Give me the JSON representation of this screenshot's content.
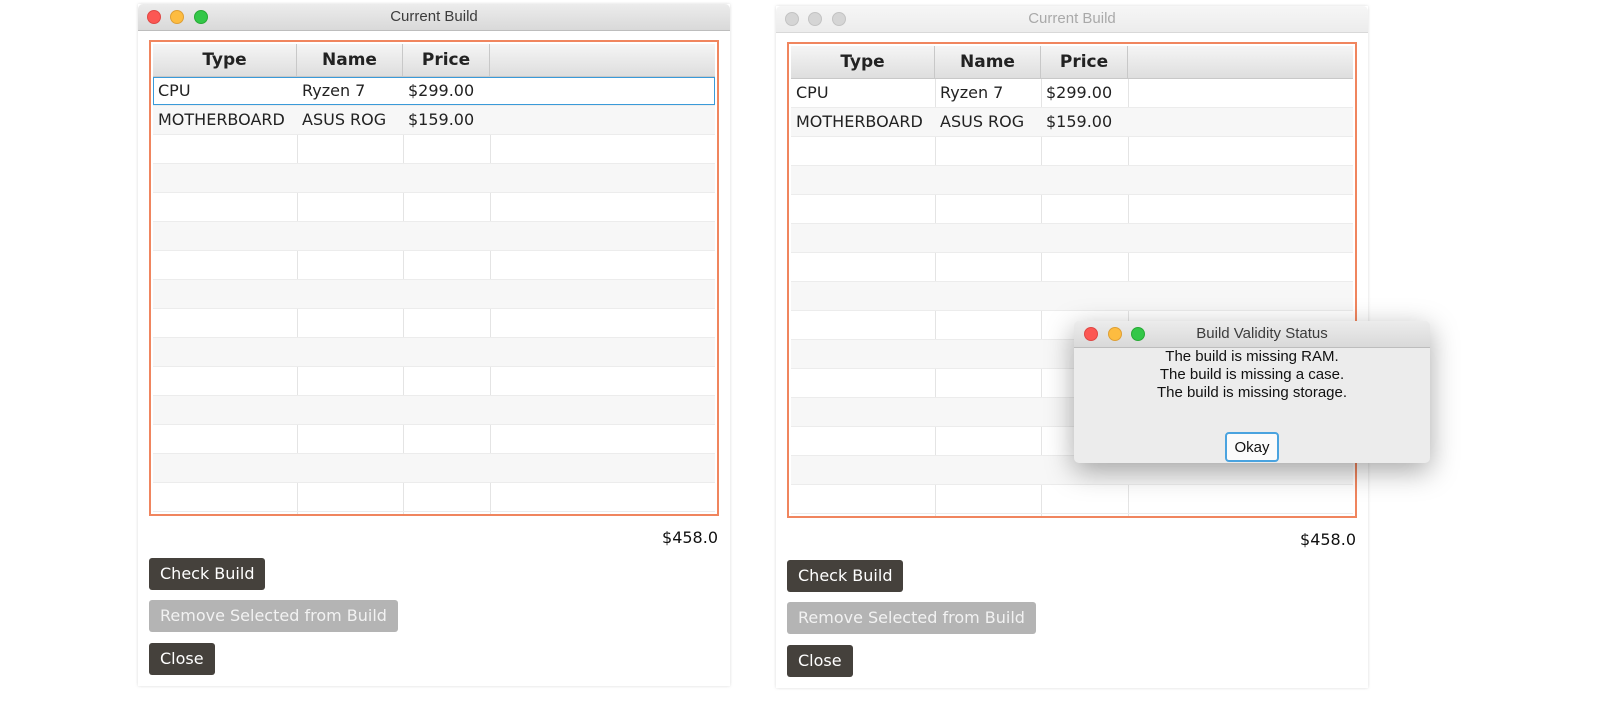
{
  "left_window": {
    "title": "Current Build",
    "columns": [
      "Type",
      "Name",
      "Price"
    ],
    "rows": [
      {
        "type": "CPU",
        "name": "Ryzen 7",
        "price": "$299.00"
      },
      {
        "type": "MOTHERBOARD",
        "name": "ASUS ROG",
        "price": "$159.00"
      }
    ],
    "total": "$458.0",
    "buttons": {
      "check": "Check Build",
      "remove": "Remove Selected from Build",
      "close": "Close"
    }
  },
  "right_window": {
    "title": "Current Build",
    "columns": [
      "Type",
      "Name",
      "Price"
    ],
    "rows": [
      {
        "type": "CPU",
        "name": "Ryzen 7",
        "price": "$299.00"
      },
      {
        "type": "MOTHERBOARD",
        "name": "ASUS ROG",
        "price": "$159.00"
      }
    ],
    "total": "$458.0",
    "buttons": {
      "check": "Check Build",
      "remove": "Remove Selected from Build",
      "close": "Close"
    }
  },
  "dialog": {
    "title": "Build Validity Status",
    "messages": [
      "The build is missing RAM.",
      "The build is missing a case.",
      "The build is missing storage."
    ],
    "ok_label": "Okay"
  },
  "colors": {
    "table_border": "#f0855e",
    "focus": "#3a9ad9",
    "button": "#45413c",
    "button_disabled": "#b4b4b4"
  }
}
